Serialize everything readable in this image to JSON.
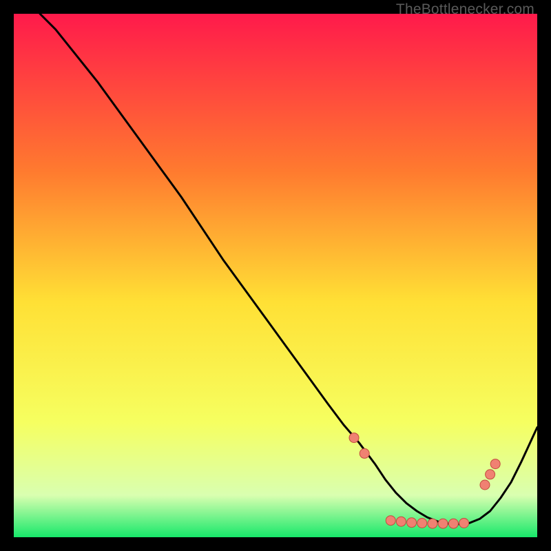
{
  "watermark": "TheBottlenecker.com",
  "colors": {
    "gradient_top": "#ff1a4b",
    "gradient_mid_upper": "#ff7a2f",
    "gradient_mid": "#ffe035",
    "gradient_mid_lower": "#f6ff60",
    "gradient_green_pale": "#d9ffb0",
    "gradient_green": "#17e86a",
    "curve": "#000000",
    "dot_fill": "#f08172",
    "dot_stroke": "#c24b3d",
    "frame": "#000000"
  },
  "chart_data": {
    "type": "line",
    "title": "",
    "xlabel": "",
    "ylabel": "",
    "xlim": [
      0,
      100
    ],
    "ylim": [
      0,
      100
    ],
    "legend": false,
    "grid": false,
    "series": [
      {
        "name": "bottleneck-curve",
        "x": [
          5,
          8,
          12,
          16,
          20,
          24,
          28,
          32,
          36,
          40,
          44,
          48,
          52,
          56,
          60,
          63,
          66,
          69,
          71,
          73,
          75,
          77,
          79,
          81,
          83,
          85,
          87,
          89,
          91,
          93,
          95,
          97,
          100
        ],
        "y": [
          100,
          97,
          92,
          87,
          81.5,
          76,
          70.5,
          65,
          59,
          53,
          47.5,
          42,
          36.5,
          31,
          25.5,
          21.5,
          18,
          14,
          11,
          8.5,
          6.5,
          5,
          3.8,
          3,
          2.6,
          2.5,
          2.7,
          3.5,
          5,
          7.5,
          10.5,
          14.5,
          21
        ]
      }
    ],
    "markers": {
      "name": "highlight-dots",
      "points": [
        {
          "x": 65,
          "y": 19
        },
        {
          "x": 67,
          "y": 16
        },
        {
          "x": 72,
          "y": 3.2
        },
        {
          "x": 74,
          "y": 3.0
        },
        {
          "x": 76,
          "y": 2.8
        },
        {
          "x": 78,
          "y": 2.7
        },
        {
          "x": 80,
          "y": 2.6
        },
        {
          "x": 82,
          "y": 2.6
        },
        {
          "x": 84,
          "y": 2.6
        },
        {
          "x": 86,
          "y": 2.7
        },
        {
          "x": 90,
          "y": 10
        },
        {
          "x": 91,
          "y": 12
        },
        {
          "x": 92,
          "y": 14
        }
      ]
    }
  }
}
